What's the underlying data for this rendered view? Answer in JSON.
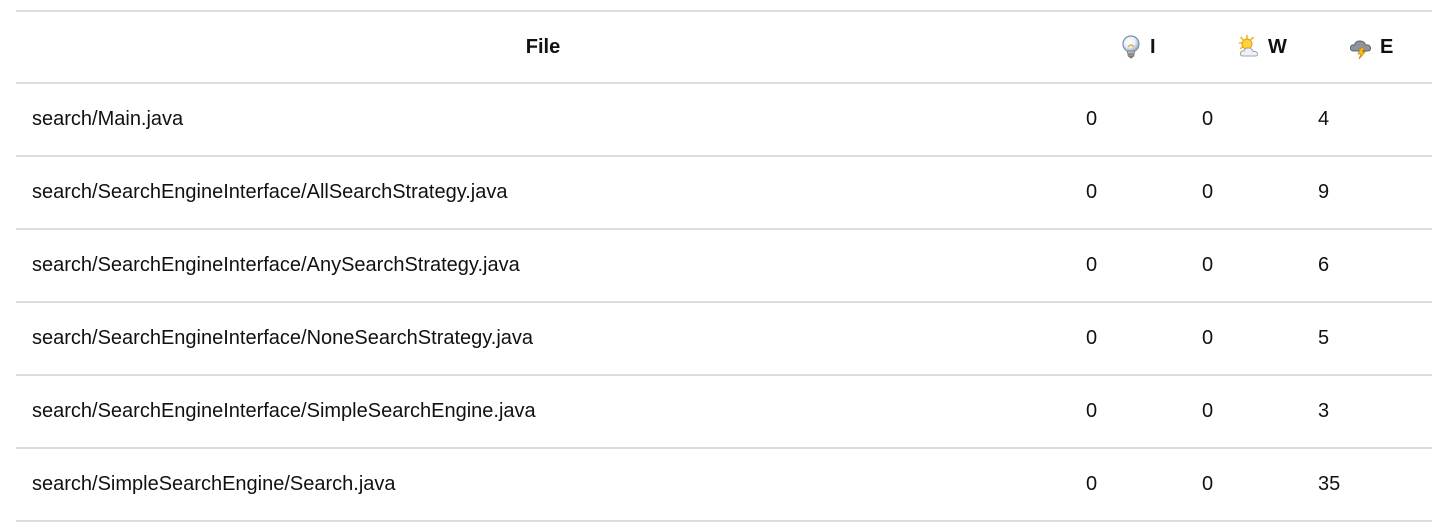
{
  "table": {
    "headers": {
      "file": "File",
      "info": {
        "label": "I",
        "icon": "lightbulb-icon"
      },
      "warnings": {
        "label": "W",
        "icon": "partly-sunny-icon"
      },
      "errors": {
        "label": "E",
        "icon": "storm-cloud-icon"
      }
    },
    "rows": [
      {
        "file": "search/Main.java",
        "i": "0",
        "w": "0",
        "e": "4"
      },
      {
        "file": "search/SearchEngineInterface/AllSearchStrategy.java",
        "i": "0",
        "w": "0",
        "e": "9"
      },
      {
        "file": "search/SearchEngineInterface/AnySearchStrategy.java",
        "i": "0",
        "w": "0",
        "e": "6"
      },
      {
        "file": "search/SearchEngineInterface/NoneSearchStrategy.java",
        "i": "0",
        "w": "0",
        "e": "5"
      },
      {
        "file": "search/SearchEngineInterface/SimpleSearchEngine.java",
        "i": "0",
        "w": "0",
        "e": "3"
      },
      {
        "file": "search/SimpleSearchEngine/Search.java",
        "i": "0",
        "w": "0",
        "e": "35"
      }
    ]
  }
}
